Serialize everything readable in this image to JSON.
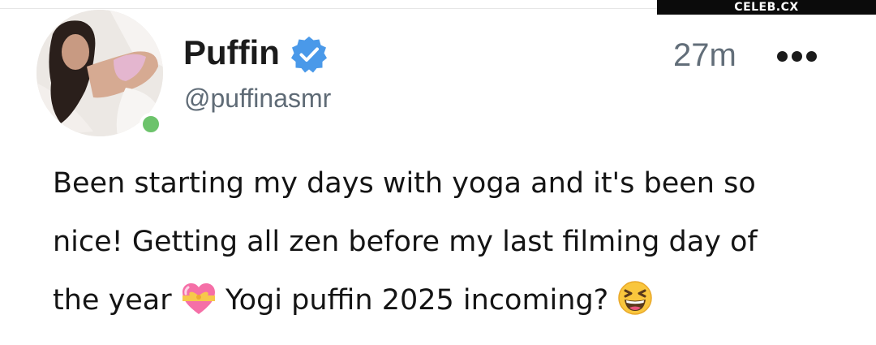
{
  "watermark": "CELEB.CX",
  "post": {
    "author_name": "Puffin",
    "handle": "@puffinasmr",
    "timestamp": "27m",
    "verified": true,
    "online": true,
    "body_lines": [
      "Been starting my days with yoga and it's been so",
      "nice! Getting all zen before my last filming day of",
      "the year",
      "Yogi puffin 2025 incoming?"
    ],
    "emojis": [
      "gift-heart-emoji",
      "grinning-squinting-face-emoji"
    ]
  },
  "colors": {
    "verified_badge": "#4a99e9",
    "online_status": "#6cc36b",
    "secondary_text": "#5f6b76"
  }
}
